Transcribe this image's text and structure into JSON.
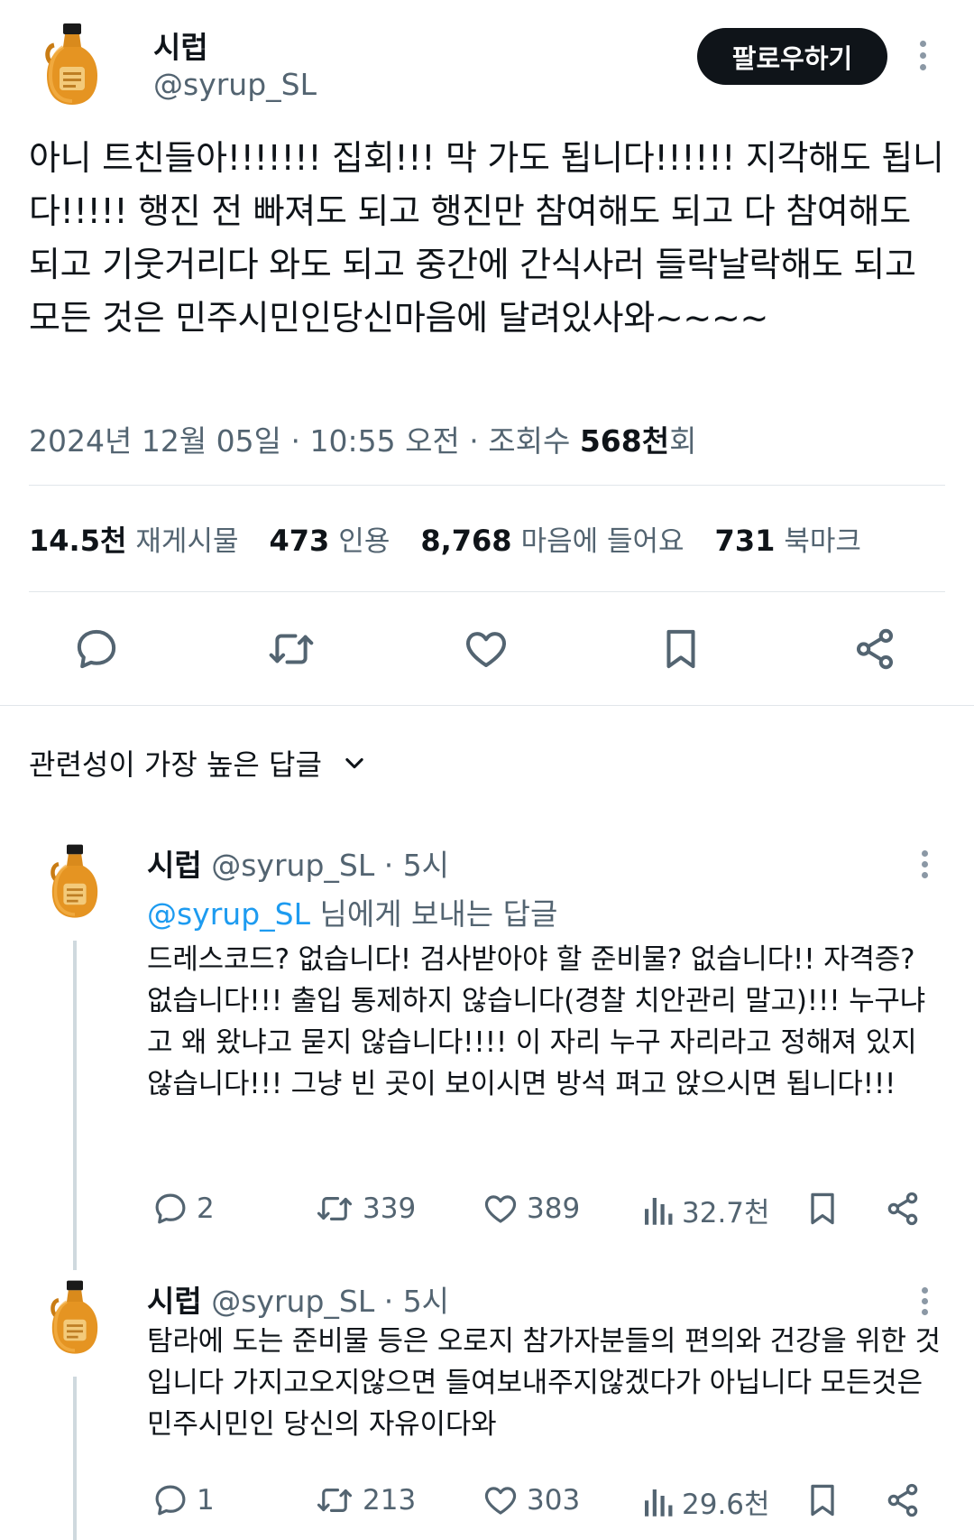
{
  "main_tweet": {
    "author": {
      "name": "시럽",
      "handle": "@syrup_SL"
    },
    "follow_label": "팔로우하기",
    "text": "아니 트친들아!!!!!!! 집회!!! 막 가도 됩니다!!!!!! 지각해도 됩니다!!!!! 행진 전 빠져도 되고 행진만 참여해도 되고 다 참여해도 되고 기웃거리다 와도 되고 중간에 간식사러 들락날락해도 되고 모든 것은 민주시민인당신마음에 달려있사와~~~~",
    "meta": {
      "datetime": "2024년 12월 05일 · 10:55 오전 · 조회수 ",
      "views": "568천",
      "views_suffix": "회"
    },
    "stats": {
      "retweets": {
        "value": "14.5천",
        "label": "재게시물"
      },
      "quotes": {
        "value": "473",
        "label": "인용"
      },
      "likes": {
        "value": "8,768",
        "label": "마음에 들어요"
      },
      "bookmarks": {
        "value": "731",
        "label": "북마크"
      }
    }
  },
  "replies_section": {
    "title": "관련성이 가장 높은 답글"
  },
  "replies": [
    {
      "name": "시럽",
      "handle": "@syrup_SL · 5시",
      "reply_to_mention": "@syrup_SL",
      "reply_to_suffix": " 님에게 보내는 답글",
      "text": "드레스코드? 없습니다! 검사받아야 할 준비물? 없습니다!! 자격증? 없습니다!!! 출입 통제하지 않습니다(경찰 치안관리 말고)!!! 누구냐고 왜 왔냐고 묻지 않습니다!!!! 이 자리 누구 자리라고 정해져 있지 않습니다!!! 그냥 빈 곳이 보이시면 방석 펴고 앉으시면 됩니다!!!",
      "metrics": {
        "replies": "2",
        "retweets": "339",
        "likes": "389",
        "views": "32.7천"
      }
    },
    {
      "name": "시럽",
      "handle": "@syrup_SL · 5시",
      "text": "탐라에 도는 준비물 등은 오로지 참가자분들의 편의와 건강을 위한 것입니다 가지고오지않으면 들여보내주지않겠다가 아닙니다 모든것은 민주시민인 당신의 자유이다와",
      "metrics": {
        "replies": "1",
        "retweets": "213",
        "likes": "303",
        "views": "29.6천"
      }
    }
  ],
  "colors": {
    "text": "#0f1419",
    "secondary": "#536471",
    "link": "#1d9bf0",
    "divider": "#e1e6ea"
  }
}
